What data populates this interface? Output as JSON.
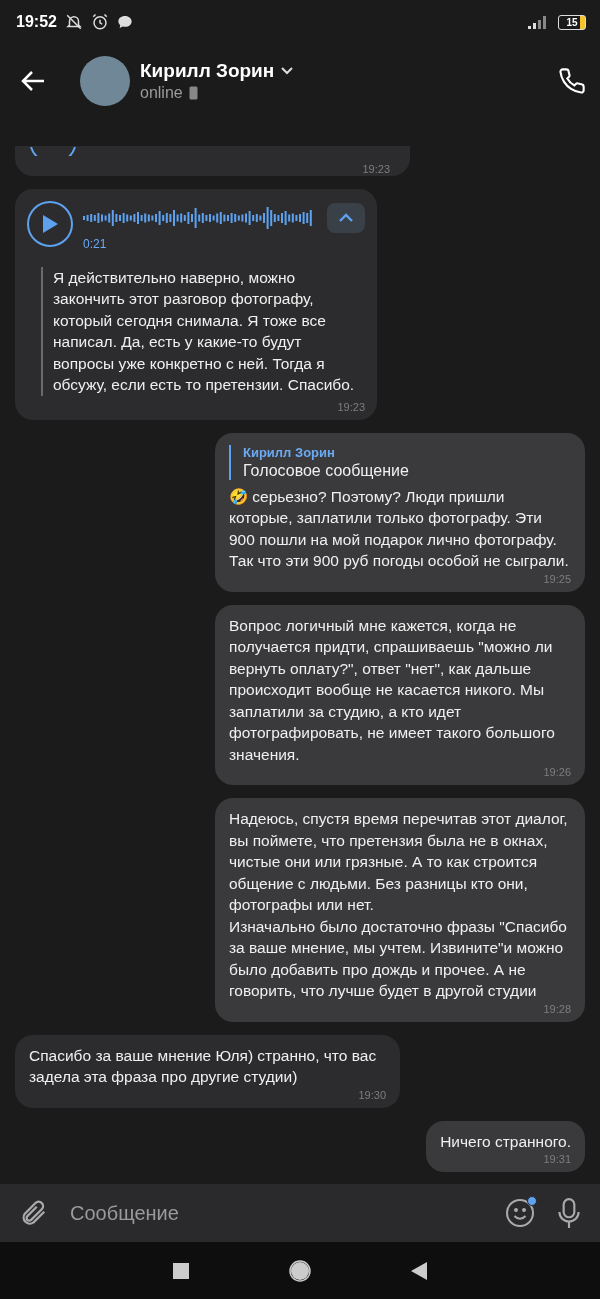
{
  "status_bar": {
    "time": "19:52",
    "battery": "15"
  },
  "header": {
    "name": "Кирилл Зорин",
    "status": "online"
  },
  "messages": [
    {
      "kind": "voice_cut",
      "outgoing": false,
      "time": "19:23"
    },
    {
      "kind": "voice",
      "outgoing": false,
      "duration": "0:21",
      "transcript_expanded": true,
      "transcript": "Я действительно наверно, можно закончить этот разговор фотографу, который сегодня снимала. Я тоже все написал. Да, есть у какие-то будут вопросы уже конкретно с ней. Тогда я обсужу, если есть то претензии. Спасибо.",
      "time": "19:23"
    },
    {
      "kind": "text",
      "outgoing": true,
      "reply": {
        "author": "Кирилл Зорин",
        "text": "Голосовое сообщение"
      },
      "text": "🤣 серьезно? Поэтому? Люди пришли которые, заплатили только фотографу. Эти 900 пошли на мой подарок лично фотографу. Так что эти 900 руб погоды особой не сыграли.",
      "time": "19:25"
    },
    {
      "kind": "text",
      "outgoing": true,
      "text": "Вопрос логичный мне кажется, когда не получается придти, спрашиваешь \"можно ли вернуть оплату?\", ответ \"нет\", как дальше происходит вообще не касается никого. Мы заплатили за студию, а кто идет фотографировать, не имеет такого большого значения.",
      "time": "19:26"
    },
    {
      "kind": "text",
      "outgoing": true,
      "text": "Надеюсь, спустя время перечитав этот диалог, вы поймете, что претензия была не в окнах, чистые они или грязные. А то как строится общение с людьми. Без разницы кто они, фотографы или нет.\nИзначально было достаточно фразы \"Спасибо за ваше мнение, мы учтем. Извините\"и можно было добавить про дождь и прочее. А не говорить, что лучше будет в другой студии",
      "time": "19:28"
    },
    {
      "kind": "text",
      "outgoing": false,
      "text": "Спасибо за ваше мнение Юля) странно, что вас задела эта фраза про другие студии)",
      "time": "19:30"
    },
    {
      "kind": "text",
      "outgoing": true,
      "text": "Ничего странного.",
      "time": "19:31"
    }
  ],
  "composer": {
    "placeholder": "Сообщение",
    "emoji_badge": true
  }
}
